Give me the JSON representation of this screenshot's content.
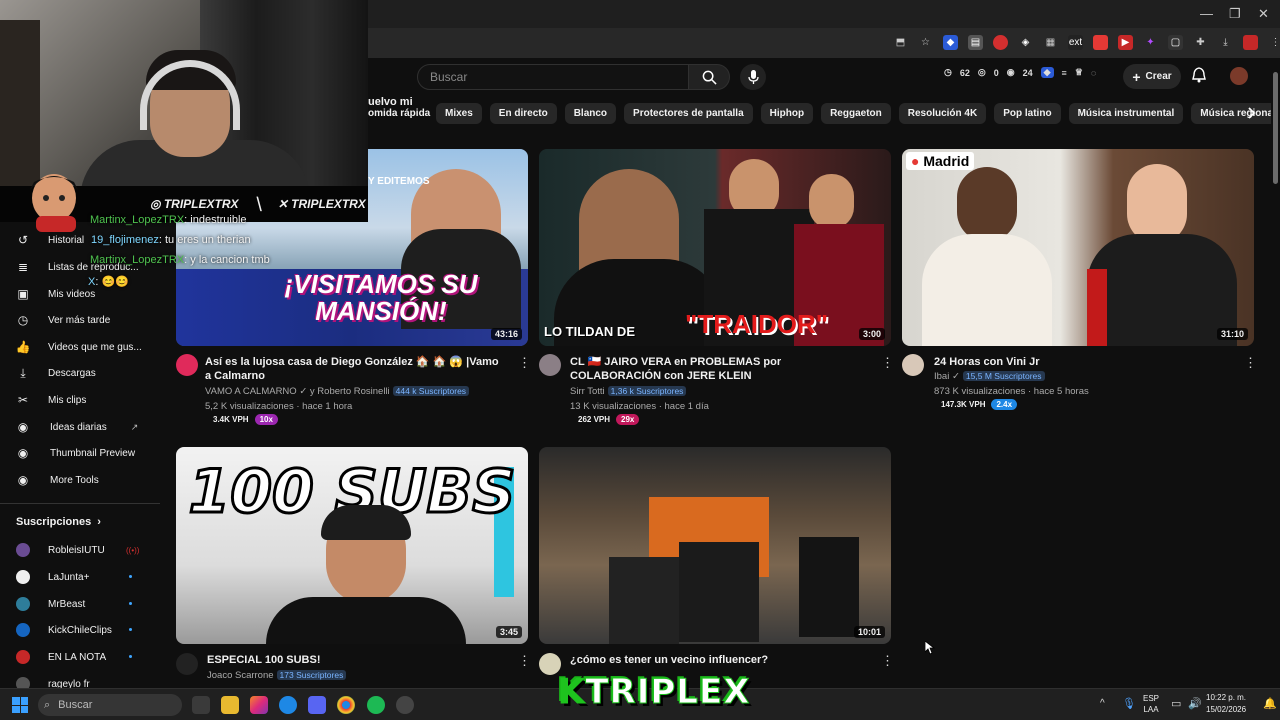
{
  "search": {
    "placeholder": "Buscar"
  },
  "header": {
    "stats": [
      "62",
      "0",
      "24"
    ],
    "create_label": "Crear"
  },
  "chips": [
    "Mixes",
    "En directo",
    "Blanco",
    "Protectores de pantalla",
    "Hiphop",
    "Reggaeton",
    "Resolución 4K",
    "Pop latino",
    "Música instrumental",
    "Música regional mexicana"
  ],
  "partial_chip": [
    "uelvo mi",
    "omida rápida"
  ],
  "overlay": {
    "instagram": "TRIPLEXTRX",
    "x": "TRIPLEXTRX",
    "brand": "TRIPLEX"
  },
  "chat": [
    {
      "user": "Martinx_LopezTRX",
      "msg": ": indestruible"
    },
    {
      "user": "19_flojimenez",
      "msg": ": tu eres un therian"
    },
    {
      "user": "Martinx_LopezTRX",
      "msg": ": y la cancion tmb"
    },
    {
      "user": "X",
      "msg": ": 😊😊"
    }
  ],
  "sidebar": {
    "items": [
      "Historial",
      "Listas de reproduc...",
      "Mis videos",
      "Ver más tarde",
      "Videos que me gus...",
      "Descargas",
      "Mis clips",
      "Ideas diarias",
      "Thumbnail Preview",
      "More Tools"
    ],
    "subs_heading": "Suscripciones",
    "subs": [
      "RobleisIUTU",
      "LaJunta+",
      "MrBeast",
      "KickChileClips",
      "EN LA NOTA",
      "rageylo fr"
    ]
  },
  "videos": [
    {
      "title": "Así es la lujosa casa de Diego González 🏠 🏠 😱 |Vamo a Calmarno",
      "channel": "VAMO A CALMARNO ✓ y Roberto Rosinelli",
      "subs": "444 k Suscriptores",
      "meta": "5,2 K visualizaciones · hace 1 hora",
      "vph": "3.4K VPH",
      "mult": "10x",
      "duration": "43:16",
      "thumb_text": "¡VISITAMOS SU MANSIÓN!",
      "thumb_top": "Y EDITEMOS"
    },
    {
      "title": "CL 🇨🇱 JAIRO VERA en PROBLEMAS por COLABORACIÓN con JERE KLEIN",
      "channel": "Sirr Totti",
      "subs": "1,36 k Suscriptores",
      "meta": "13 K visualizaciones · hace 1 día",
      "vph": "262 VPH",
      "mult": "29x",
      "duration": "3:00",
      "thumb_text_a": "LO TILDAN DE",
      "thumb_text_b": "\"TRAIDOR\""
    },
    {
      "title": "24 Horas con Vini Jr",
      "channel": "Ibai ✓",
      "subs": "15,5 M Suscriptores",
      "meta": "873 K visualizaciones · hace 5 horas",
      "vph": "147.3K VPH",
      "mult": "2.4x",
      "duration": "31:10",
      "thumb_tag": "Madrid"
    },
    {
      "title": "ESPECIAL 100 SUBS!",
      "channel": "Joaco Scarrone",
      "subs": "173 Suscriptores",
      "duration": "3:45",
      "thumb_text": "100 SUBS"
    },
    {
      "title": "¿cómo es tener un vecino influencer?",
      "duration": "10:01"
    }
  ],
  "taskbar": {
    "search": "Buscar",
    "lang_a": "ESP",
    "lang_b": "LAA",
    "time": "10:22 p. m.",
    "date": "15/02/2026"
  },
  "colors": {
    "accent": "#3ea6ff",
    "vph_mult_1": "#9c27b0",
    "vph_mult_2": "#c2185b",
    "vph_mult_3": "#1e88e5"
  }
}
